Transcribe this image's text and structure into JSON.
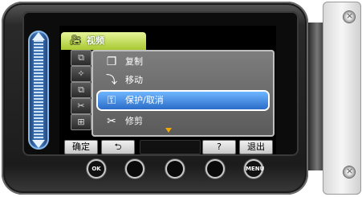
{
  "menu": {
    "title": "视频",
    "title_icon": "video-camera-icon",
    "items": [
      {
        "label": "复制",
        "icon": "copy-icon"
      },
      {
        "label": "移动",
        "icon": "move-icon"
      },
      {
        "label": "保护/取消",
        "icon": "key-icon",
        "selected": true
      },
      {
        "label": "修剪",
        "icon": "trim-icon"
      }
    ]
  },
  "side_tabs": [
    "⧉",
    "✧",
    "⧉",
    "✂",
    "⊞"
  ],
  "softkeys": {
    "confirm": "确定",
    "back": "⮌",
    "help": "?",
    "exit": "退出"
  },
  "hardware": {
    "ok_label": "OK",
    "menu_label": "MENU"
  },
  "colors": {
    "selected_highlight": "#2a6cc8",
    "title_tab": "#a8c830",
    "slider": "#4a8ad0"
  }
}
